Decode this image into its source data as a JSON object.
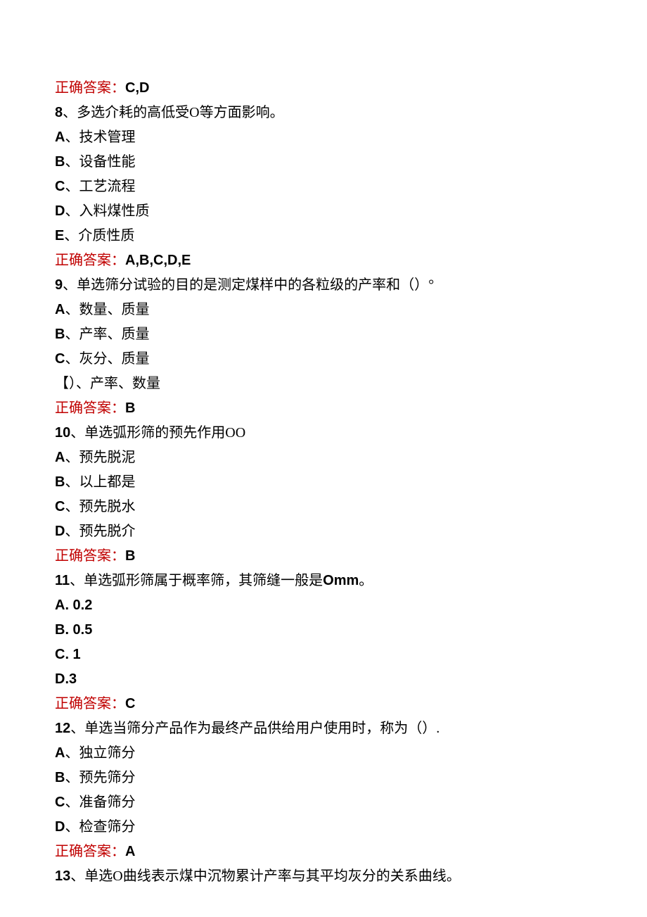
{
  "lines": {
    "ans7_label": "正确答案：",
    "ans7_value": "C,D",
    "q8_num": "8",
    "q8_text": "、多选介耗的高低受O等方面影响。",
    "q8_a_letter": "A",
    "q8_a_text": "、技术管理",
    "q8_b_letter": "B",
    "q8_b_text": "、设备性能",
    "q8_c_letter": "C",
    "q8_c_text": "、工艺流程",
    "q8_d_letter": "D",
    "q8_d_text": "、入料煤性质",
    "q8_e_letter": "E",
    "q8_e_text": "、介质性质",
    "ans8_label": "正确答案：",
    "ans8_value": "A,B,C,D,E",
    "q9_num": "9",
    "q9_text": "、单选筛分试验的目的是测定煤样中的各粒级的产率和（）°",
    "q9_a_letter": "A",
    "q9_a_text": "、数量、质量",
    "q9_b_letter": "B",
    "q9_b_text": "、产率、质量",
    "q9_c_letter": "C",
    "q9_c_text": "、灰分、质量",
    "q9_d_text": "【）、产率、数量",
    "ans9_label": "正确答案：",
    "ans9_value": "B",
    "q10_num": "10",
    "q10_text": "、单选弧形筛的预先作用OO",
    "q10_a_letter": "A",
    "q10_a_text": "、预先脱泥",
    "q10_b_letter": "B",
    "q10_b_text": "、以上都是",
    "q10_c_letter": "C",
    "q10_c_text": "、预先脱水",
    "q10_d_letter": "D",
    "q10_d_text": "、预先脱介",
    "ans10_label": "正确答案：",
    "ans10_value": "B",
    "q11_num": "11",
    "q11_text_a": "、单选弧形筛属于概率筛，其筛缝一般是",
    "q11_text_b": "Omm",
    "q11_text_c": "。",
    "q11_a": "A.  0.2",
    "q11_b": "B.  0.5",
    "q11_c": "C.  1",
    "q11_d": "D.3",
    "ans11_label": "正确答案：",
    "ans11_value": "C",
    "q12_num": "12",
    "q12_text": "、单选当筛分产品作为最终产品供给用户使用时，称为（）.",
    "q12_a_letter": "A",
    "q12_a_text": "、独立筛分",
    "q12_b_letter": "B",
    "q12_b_text": "、预先筛分",
    "q12_c_letter": "C",
    "q12_c_text": "、准备筛分",
    "q12_d_letter": "D",
    "q12_d_text": "、检查筛分",
    "ans12_label": "正确答案：",
    "ans12_value": "A",
    "q13_num": "13",
    "q13_text": "、单选O曲线表示煤中沉物累计产率与其平均灰分的关系曲线。"
  }
}
